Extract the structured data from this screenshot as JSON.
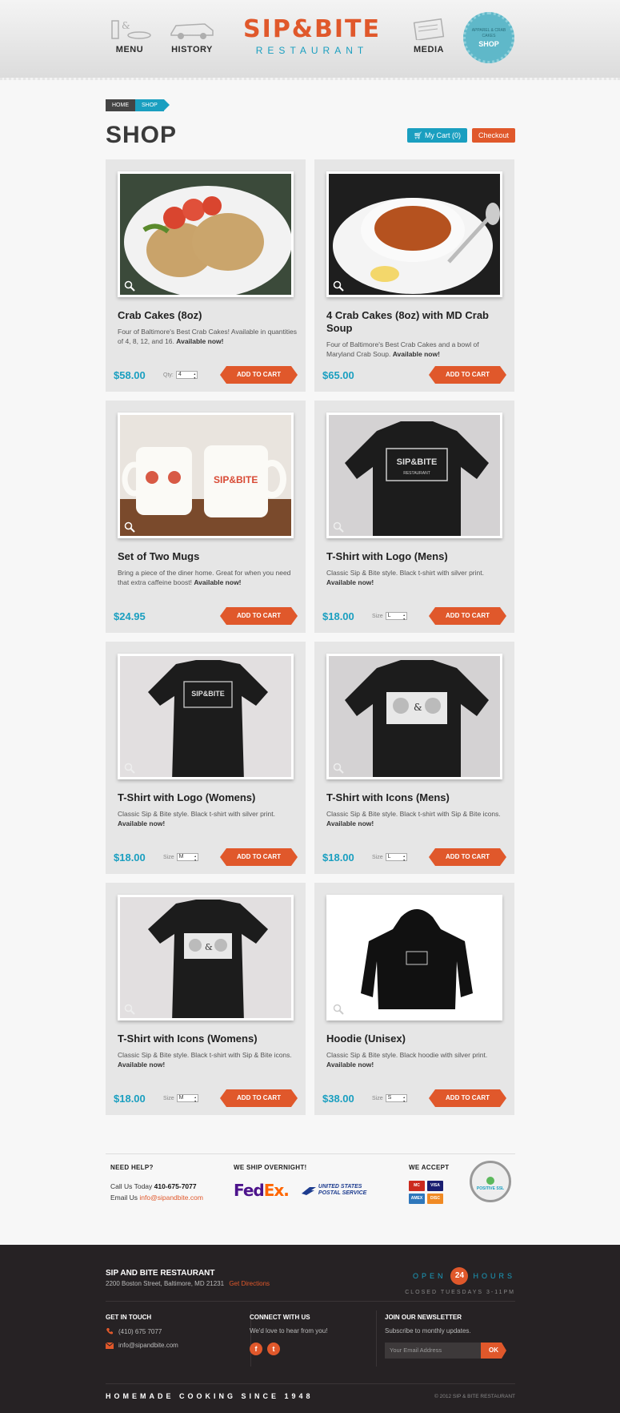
{
  "header": {
    "logo_main": "SIP&BITE",
    "logo_sub": "RESTAURANT",
    "nav": [
      {
        "label": "MENU",
        "icon": "coffee-cup-icon"
      },
      {
        "label": "HISTORY",
        "icon": "car-icon"
      },
      {
        "label": "MEDIA",
        "icon": "press-icon"
      }
    ],
    "badge": {
      "top": "APPAREL & CRAB CAKES",
      "label": "SHOP"
    }
  },
  "breadcrumb": {
    "home": "HOME",
    "current": "SHOP"
  },
  "page_title": "SHOP",
  "cart": {
    "label": "My Cart (0)",
    "checkout": "Checkout"
  },
  "products": [
    {
      "title": "Crab Cakes (8oz)",
      "desc": "Four of Baltimore's Best Crab Cakes! Available in quantities of 4, 8, 12, and 16.",
      "avail": "Available now!",
      "price": "$58.00",
      "option_label": "Qty:",
      "option_value": "4",
      "button": "ADD TO CART"
    },
    {
      "title": "4 Crab Cakes (8oz) with MD Crab Soup",
      "desc": "Four of Baltimore's Best Crab Cakes and a bowl of Maryland Crab Soup.",
      "avail": "Available now!",
      "price": "$65.00",
      "option_label": "",
      "option_value": "",
      "button": "ADD TO CART"
    },
    {
      "title": "Set of Two Mugs",
      "desc": "Bring a piece of the diner home. Great for when you need that extra caffeine boost!",
      "avail": "Available now!",
      "price": "$24.95",
      "option_label": "",
      "option_value": "",
      "button": "ADD TO CART"
    },
    {
      "title": "T-Shirt with Logo (Mens)",
      "desc": "Classic Sip & Bite style. Black t-shirt with silver print.",
      "avail": "Available now!",
      "price": "$18.00",
      "option_label": "Size",
      "option_value": "L",
      "button": "ADD TO CART"
    },
    {
      "title": "T-Shirt with Logo (Womens)",
      "desc": "Classic Sip & Bite style. Black t-shirt with silver print.",
      "avail": "Available now!",
      "price": "$18.00",
      "option_label": "Size",
      "option_value": "M",
      "button": "ADD TO CART"
    },
    {
      "title": "T-Shirt with Icons (Mens)",
      "desc": "Classic Sip & Bite style. Black t-shirt with Sip & Bite icons.",
      "avail": "Available now!",
      "price": "$18.00",
      "option_label": "Size",
      "option_value": "L",
      "button": "ADD TO CART"
    },
    {
      "title": "T-Shirt with Icons (Womens)",
      "desc": "Classic Sip & Bite style. Black t-shirt with Sip & Bite icons.",
      "avail": "Available now!",
      "price": "$18.00",
      "option_label": "Size",
      "option_value": "M",
      "button": "ADD TO CART"
    },
    {
      "title": "Hoodie (Unisex)",
      "desc": "Classic Sip & Bite style. Black hoodie with silver print.",
      "avail": "Available now!",
      "price": "$38.00",
      "option_label": "Size",
      "option_value": "S",
      "button": "ADD TO CART"
    }
  ],
  "info": {
    "help_heading": "NEED HELP?",
    "call_prefix": "Call Us Today",
    "phone": "410-675-7077",
    "email_prefix": "Email Us",
    "email": "info@sipandbite.com",
    "ship_heading": "WE SHIP OVERNIGHT!",
    "fedex_fe": "Fed",
    "fedex_ex": "Ex.",
    "usps_line1": "UNITED STATES",
    "usps_line2": "POSTAL SERVICE",
    "accept_heading": "WE ACCEPT",
    "cards": [
      "MC",
      "VISA",
      "AMEX",
      "DISC"
    ],
    "ssl_label": "POSITIVE SSL"
  },
  "footer": {
    "name": "SIP AND BITE RESTAURANT",
    "address": "2200 Boston Street, Baltimore, MD 21231",
    "directions": "Get Directions",
    "open_left": "OPEN",
    "open_num": "24",
    "open_right": "HOURS",
    "closed": "CLOSED TUESDAYS 3-11PM",
    "touch_heading": "GET IN TOUCH",
    "phone": "(410) 675 7077",
    "email": "info@sipandbite.com",
    "connect_heading": "CONNECT WITH US",
    "connect_text": "We'd love to hear from you!",
    "newsletter_heading": "JOIN OUR NEWSLETTER",
    "newsletter_text": "Subscribe to monthly updates.",
    "newsletter_placeholder": "Your Email Address",
    "newsletter_button": "OK",
    "tagline": "HOMEMADE COOKING SINCE 1948",
    "copyright": "© 2012 SIP & BITE RESTAURANT"
  },
  "colors": {
    "accent": "#e0582b",
    "brand_blue": "#1a9fc0",
    "footer_bg": "#262224"
  }
}
